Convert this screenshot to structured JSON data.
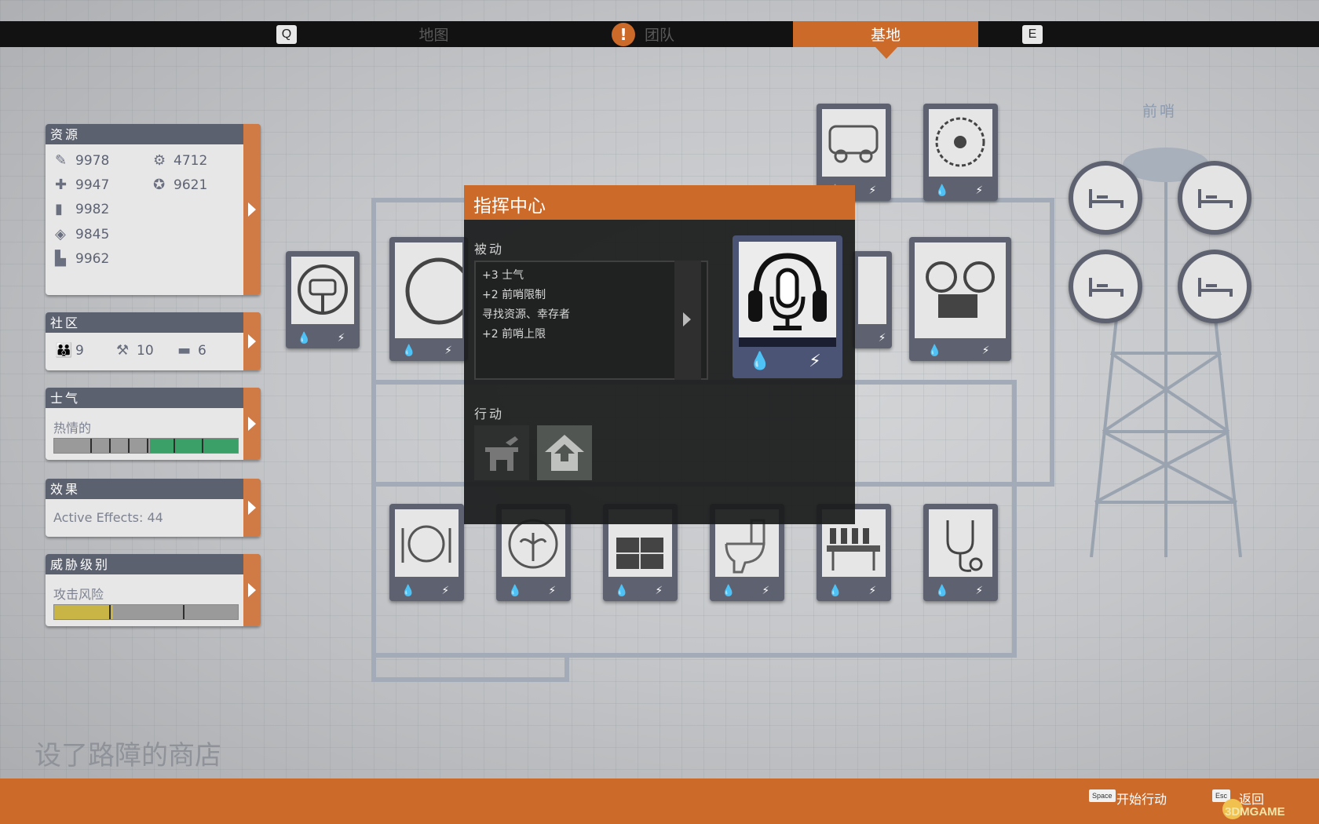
{
  "nav": {
    "key_left": "Q",
    "key_right": "E",
    "tabs": [
      "地图",
      "团队",
      "基地"
    ],
    "active_tab": "基地",
    "alert": "!"
  },
  "panels": {
    "resources": {
      "title": "资源",
      "food": "9978",
      "medicine": "9947",
      "ammo": "9982",
      "materials": "9845",
      "fuel": "9962",
      "parts": "4712",
      "influence": "9621"
    },
    "community": {
      "title": "社区",
      "survivors": "9",
      "workers": "10",
      "beds": "6"
    },
    "morale": {
      "title": "士气",
      "status": "热情的",
      "level_fraction": 0.48
    },
    "effects": {
      "title": "效果",
      "text": "Active Effects: 44"
    },
    "threat": {
      "title": "威胁级别",
      "label": "攻击风险",
      "level_fraction": 0.32
    }
  },
  "modal": {
    "title": "指挥中心",
    "passive_label": "被动",
    "passive": [
      "+3 士气",
      "+2 前哨限制",
      "寻找资源、幸存者",
      "+2 前哨上限"
    ],
    "actions_label": "行动"
  },
  "base": {
    "outpost_label": "前哨",
    "selected_building": "设了路障的商店"
  },
  "bottom": {
    "space_key": "Space",
    "start_action": "开始行动",
    "esc_key": "Esc",
    "back": "返回",
    "watermark": "3DMGAME"
  },
  "colors": {
    "accent_orange": "#cc6a2a",
    "panel_header": "#5c6170",
    "morale_green": "#3aa068",
    "threat_yellow": "#c9b546"
  }
}
